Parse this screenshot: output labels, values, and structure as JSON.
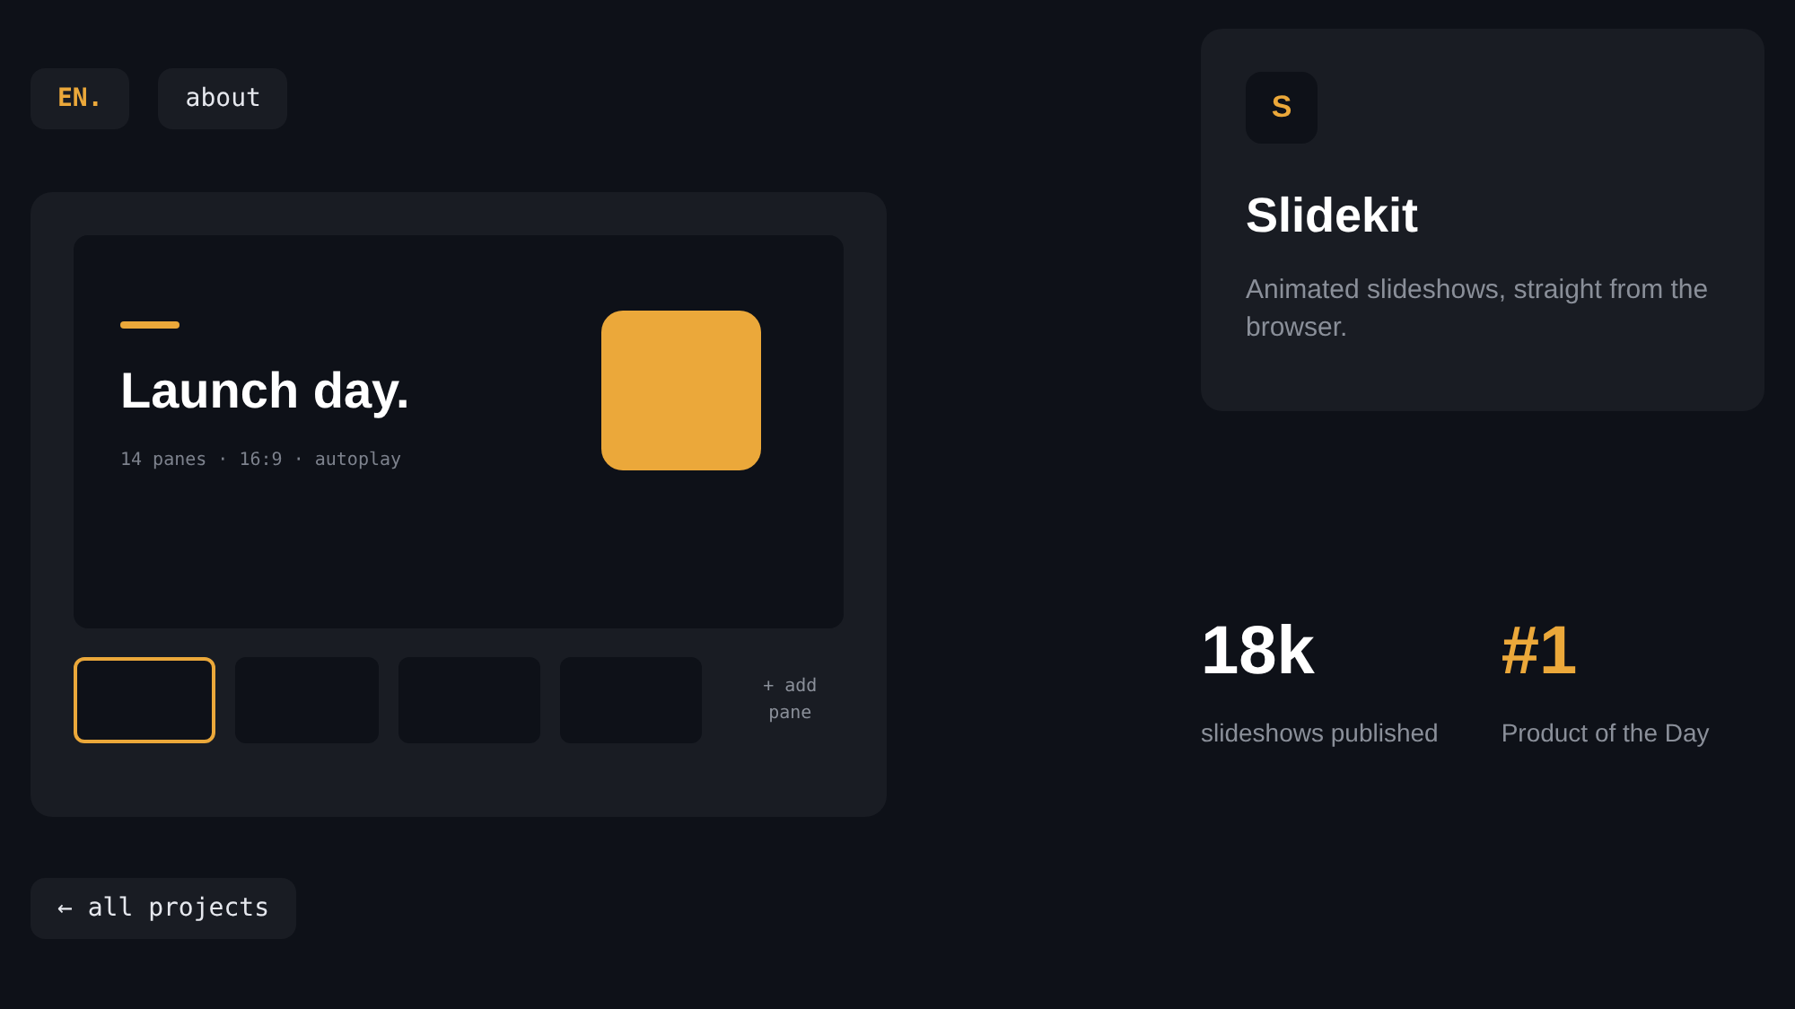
{
  "top_buttons": [
    {
      "label": "EN.",
      "accent": true
    },
    {
      "label": "about",
      "accent": false
    }
  ],
  "slide": {
    "title": "Launch day.",
    "meta": "14 panes · 16:9 · autoplay"
  },
  "thumbnails": [
    {
      "selected": true
    },
    {
      "selected": false
    },
    {
      "selected": false
    },
    {
      "selected": false
    }
  ],
  "add_pane": "+ add pane",
  "back_button": "← all projects",
  "app": {
    "logo": "S",
    "name": "Slidekit",
    "tagline": "Animated slideshows, straight from the browser."
  },
  "stats": [
    {
      "value": "18k",
      "label": "slideshows published",
      "accent": false
    },
    {
      "value": "#1",
      "label": "Product of the Day",
      "accent": true
    }
  ]
}
